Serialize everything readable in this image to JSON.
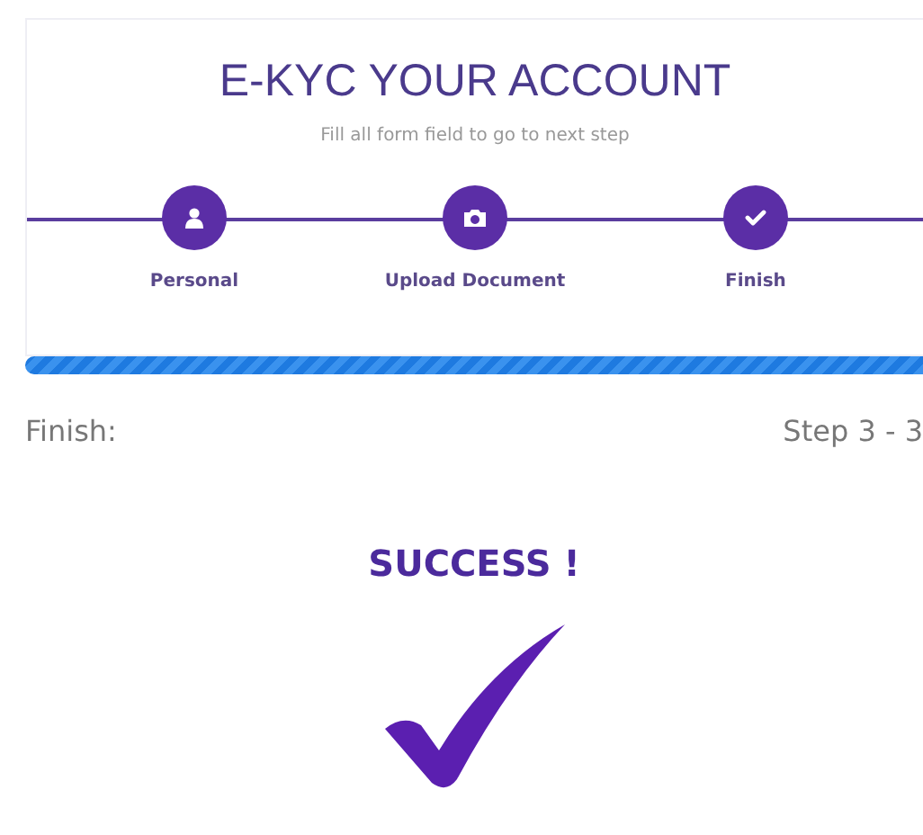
{
  "header": {
    "title": "E-KYC YOUR ACCOUNT",
    "subtitle": "Fill all form field to go to next step"
  },
  "steps": [
    {
      "label": "Personal",
      "kind": "person"
    },
    {
      "label": "Upload Document",
      "kind": "camera"
    },
    {
      "label": "Finish",
      "kind": "check"
    }
  ],
  "progress": {
    "level": 1
  },
  "step_info": {
    "label": "Finish:",
    "counter": "Step 3 - 3"
  },
  "result": {
    "message": "SUCCESS !"
  }
}
